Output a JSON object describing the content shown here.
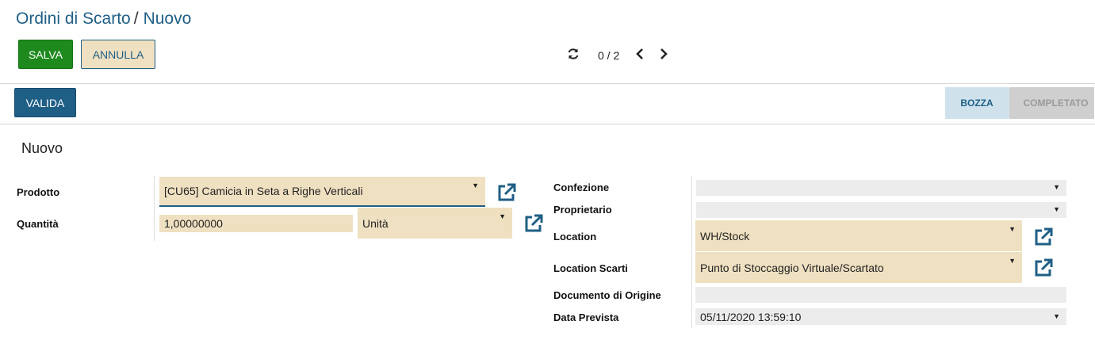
{
  "breadcrumb": {
    "parent": "Ordini di Scarto",
    "separator": "/",
    "current": "Nuovo"
  },
  "buttons": {
    "save": "SALVA",
    "cancel": "ANNULLA",
    "validate": "VALIDA"
  },
  "pager": {
    "value": "0 / 2",
    "refresh_icon": "refresh-icon",
    "prev_icon": "chevron-left-icon",
    "next_icon": "chevron-right-icon"
  },
  "stages": {
    "draft": "BOZZA",
    "done": "COMPLETATO",
    "active": "BOZZA"
  },
  "sheet": {
    "title": "Nuovo"
  },
  "form": {
    "product": {
      "label": "Prodotto",
      "value": "[CU65] Camicia in Seta a Righe Verticali"
    },
    "quantity": {
      "label": "Quantità",
      "value": "1,00000000",
      "uom": "Unità"
    },
    "package": {
      "label": "Confezione",
      "value": ""
    },
    "owner": {
      "label": "Proprietario",
      "value": ""
    },
    "location": {
      "label": "Location",
      "value": "WH/Stock"
    },
    "scrap_location": {
      "label": "Location Scarti",
      "value": "Punto di Stoccaggio Virtuale/Scartato"
    },
    "origin": {
      "label": "Documento di Origine",
      "value": ""
    },
    "date_expected": {
      "label": "Data Prevista",
      "value": "05/11/2020 13:59:10"
    }
  },
  "colors": {
    "primary": "#1f5f86",
    "save": "#1e8a1e",
    "required_field": "#efe0c1",
    "optional_field": "#ececec"
  }
}
